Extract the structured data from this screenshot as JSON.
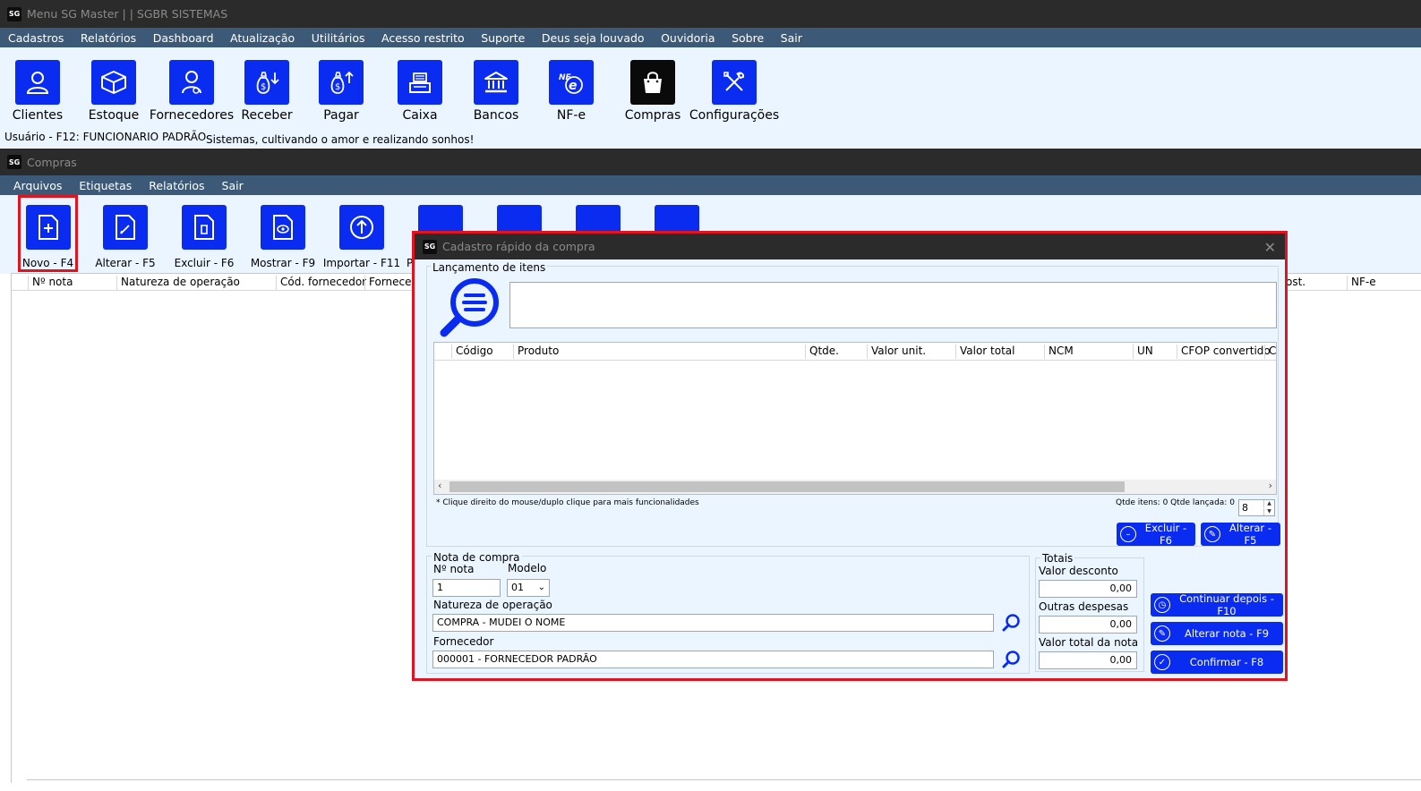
{
  "main_window": {
    "logo": "SG",
    "title": "Menu SG Master | | SGBR SISTEMAS",
    "menu": [
      "Cadastros",
      "Relatórios",
      "Dashboard",
      "Atualização",
      "Utilitários",
      "Acesso restrito",
      "Suporte",
      "Deus seja louvado",
      "Ouvidoria",
      "Sobre",
      "Sair"
    ],
    "toolbar": [
      {
        "label": "Clientes",
        "icon": "user-icon"
      },
      {
        "label": "Estoque",
        "icon": "box-icon"
      },
      {
        "label": "Fornecedores",
        "icon": "supplier-icon"
      },
      {
        "label": "Receber",
        "icon": "money-in-icon"
      },
      {
        "label": "Pagar",
        "icon": "money-out-icon"
      },
      {
        "label": "Caixa",
        "icon": "cash-register-icon"
      },
      {
        "label": "Bancos",
        "icon": "bank-icon"
      },
      {
        "label": "NF-e",
        "icon": "nfe-icon"
      },
      {
        "label": "Compras",
        "icon": "shopping-bag-icon"
      },
      {
        "label": "Configurações",
        "icon": "tools-icon"
      }
    ],
    "status_user": "Usuário - F12:  FUNCIONARIO PADRÃO",
    "status_motto": "Sistemas, cultivando o amor e realizando sonhos!"
  },
  "compras_window": {
    "logo": "SG",
    "title": "Compras",
    "menu": [
      "Arquivos",
      "Etiquetas",
      "Relatórios",
      "Sair"
    ],
    "toolbar": [
      {
        "label": "Novo - F4",
        "icon": "new-document-icon"
      },
      {
        "label": "Alterar - F5",
        "icon": "edit-document-icon"
      },
      {
        "label": "Excluir - F6",
        "icon": "delete-document-icon"
      },
      {
        "label": "Mostrar - F9",
        "icon": "view-document-icon"
      },
      {
        "label": "Importar - F11",
        "icon": "import-icon"
      },
      {
        "label": "P",
        "icon": "payment-icon"
      },
      {
        "label": "",
        "icon": "refresh-icon"
      },
      {
        "label": "",
        "icon": "mde-icon"
      },
      {
        "label": "",
        "icon": "grid-icon"
      }
    ],
    "columns": [
      "Nº nota",
      "Natureza de operação",
      "Cód. fornecedor",
      "Fornecedo",
      "ost.",
      "NF-e"
    ]
  },
  "dialog": {
    "logo": "SG",
    "title": "Cadastro rápido da compra",
    "close": "✕",
    "lancamento_legend": "Lançamento de itens",
    "search_value": "",
    "items_columns": [
      "Código",
      "Produto",
      "Qtde.",
      "Valor unit.",
      "Valor total",
      "NCM",
      "UN",
      "CFOP convertido",
      "C"
    ],
    "note": "* Clique direito do mouse/duplo clique para mais funcionalidades",
    "counts": "Qtde itens: 0 Qtde lançada: 0",
    "spin_value": "8",
    "excluir_button": "Excluir - F6",
    "alterar_button": "Alterar - F5",
    "nota_legend": "Nota de compra",
    "num_nota_label": "Nº nota",
    "num_nota_value": "1",
    "modelo_label": "Modelo",
    "modelo_value": "01",
    "natureza_label": "Natureza de operação",
    "natureza_value": "COMPRA - MUDEI O NOME",
    "fornecedor_label": "Fornecedor",
    "fornecedor_value": "000001 - FORNECEDOR PADRÃO",
    "totais_legend": "Totais",
    "desconto_label": "Valor desconto",
    "desconto_value": "0,00",
    "despesas_label": "Outras despesas",
    "despesas_value": "0,00",
    "total_label": "Valor total da nota",
    "total_value": "0,00",
    "continuar_button": "Continuar depois - F10",
    "alterar_nota_button": "Alterar nota - F9",
    "confirmar_button": "Confirmar - F8"
  },
  "colors": {
    "accent": "#0a2cf0",
    "highlight": "#e0141e",
    "menubar": "#3c5a78",
    "titlebar": "#2b2b2b",
    "panel": "#ebf5ff"
  }
}
